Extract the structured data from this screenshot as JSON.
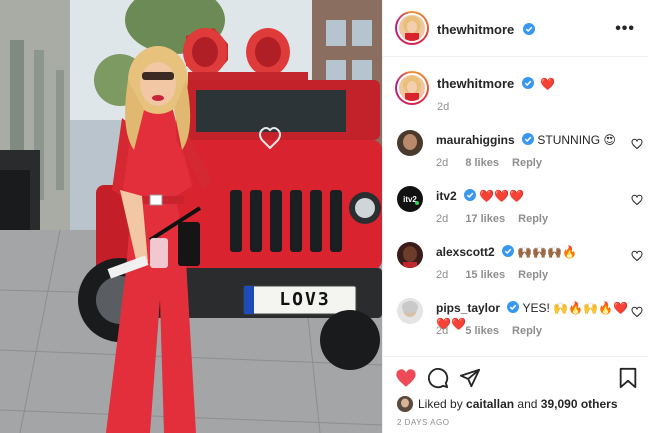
{
  "post": {
    "author": "thewhitmore",
    "caption_text": "❤️",
    "caption_age": "2d",
    "plate_text": "LOV3"
  },
  "comments": [
    {
      "user": "maurahiggins",
      "text": "STUNNING 😍",
      "age": "2d",
      "likes": "8 likes",
      "reply": "Reply"
    },
    {
      "user": "itv2",
      "text": "❤️❤️❤️",
      "age": "2d",
      "likes": "17 likes",
      "reply": "Reply"
    },
    {
      "user": "alexscott2",
      "text": "🙌🏾🙌🏾🙌🏾🔥",
      "age": "2d",
      "likes": "15 likes",
      "reply": "Reply"
    },
    {
      "user": "pips_taylor",
      "text": "YES! 🙌🔥🙌🔥❤️❤️❤️",
      "age": "2d",
      "likes": "5 likes",
      "reply": "Reply"
    }
  ],
  "likes": {
    "prefix": "Liked by",
    "first_user": "caitallan",
    "connector": "and",
    "others": "39,090 others"
  },
  "timestamp": "2 DAYS AGO",
  "colors": {
    "like_red": "#ed4956",
    "verified_blue": "#3897f0",
    "muted": "#8e8e8e",
    "jeep_red": "#d9232e"
  },
  "icons": [
    "verified-icon",
    "more-icon",
    "heart-icon",
    "comment-icon",
    "share-icon",
    "bookmark-icon"
  ]
}
